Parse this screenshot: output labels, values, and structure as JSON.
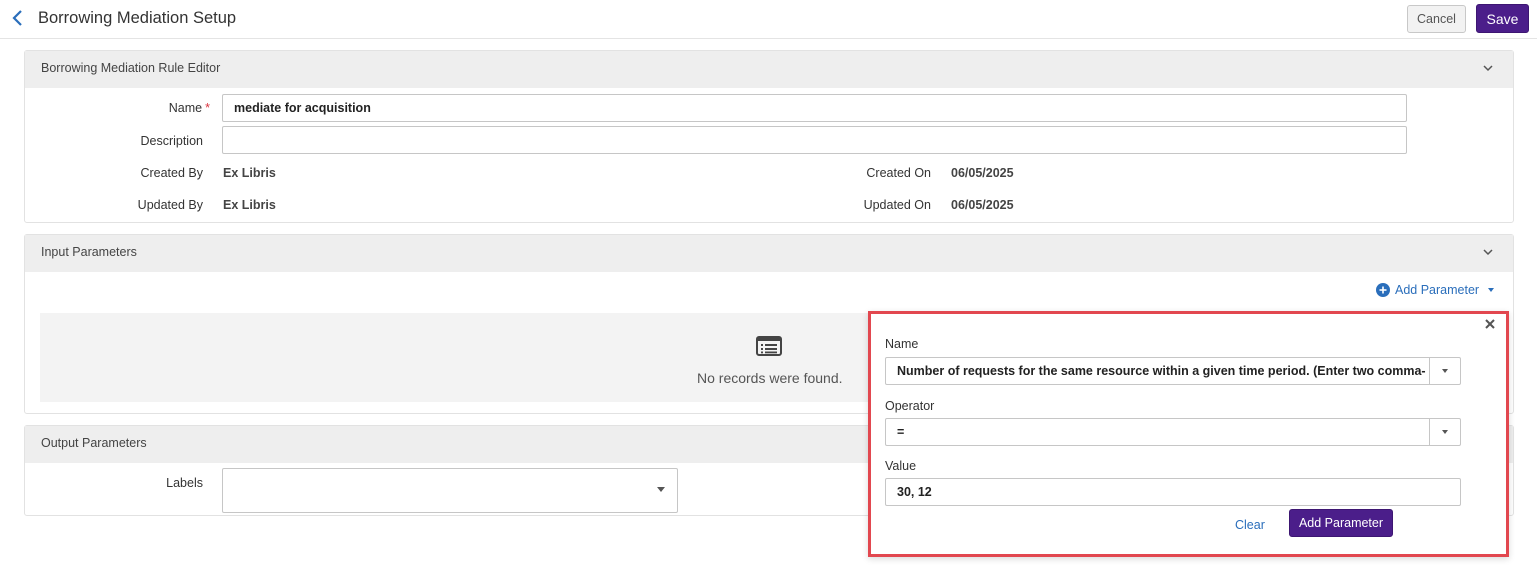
{
  "header": {
    "title": "Borrowing Mediation Setup",
    "cancel_label": "Cancel",
    "save_label": "Save"
  },
  "rule_editor": {
    "section_title": "Borrowing Mediation Rule Editor",
    "name_label": "Name",
    "required_mark": "*",
    "name_value": "mediate for acquisition",
    "description_label": "Description",
    "description_value": "",
    "created_by_label": "Created By",
    "created_by_value": "Ex Libris",
    "updated_by_label": "Updated By",
    "updated_by_value": "Ex Libris",
    "created_on_label": "Created On",
    "created_on_value": "06/05/2025",
    "updated_on_label": "Updated On",
    "updated_on_value": "06/05/2025"
  },
  "input_parameters": {
    "section_title": "Input Parameters",
    "add_parameter_label": "Add Parameter",
    "empty_message": "No records were found."
  },
  "output_parameters": {
    "section_title": "Output Parameters",
    "labels_label": "Labels",
    "labels_value": ""
  },
  "add_parameter_popover": {
    "name_label": "Name",
    "name_value": "Number of requests for the same resource within a given time period. (Enter two comma-separat",
    "operator_label": "Operator",
    "operator_value": "=",
    "value_label": "Value",
    "value_value": "30, 12",
    "clear_label": "Clear",
    "add_button_label": "Add Parameter"
  },
  "colors": {
    "primary": "#4b1e8a",
    "link": "#2a6ebb",
    "highlight_border": "#e2474f",
    "required": "#d9333f"
  }
}
